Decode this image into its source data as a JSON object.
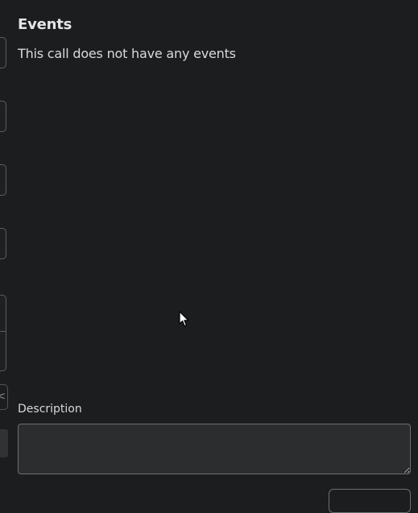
{
  "events": {
    "title": "Events",
    "empty_message": "This call does not have any events"
  },
  "description": {
    "label": "Description",
    "value": "",
    "placeholder": ""
  },
  "left_panel": {
    "pager_glyph": "<"
  },
  "icons": {
    "cursor": "mouse-pointer-icon"
  },
  "colors": {
    "background": "#1c1d1f",
    "input_background": "#2b2d2f",
    "input_border": "#6d7073",
    "text_primary": "#e4e5e6"
  }
}
